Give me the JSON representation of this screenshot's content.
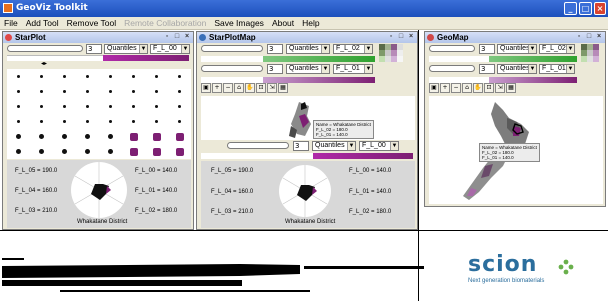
{
  "window": {
    "title": "GeoViz Toolkit",
    "controls": [
      "_",
      "□",
      "×"
    ]
  },
  "menu": {
    "items": [
      {
        "label": "File",
        "enabled": true
      },
      {
        "label": "Add Tool",
        "enabled": true
      },
      {
        "label": "Remove Tool",
        "enabled": true
      },
      {
        "label": "Remote Collaboration",
        "enabled": false
      },
      {
        "label": "Save Images",
        "enabled": true
      },
      {
        "label": "About",
        "enabled": true
      },
      {
        "label": "Help",
        "enabled": true
      }
    ]
  },
  "starplot": {
    "title": "StarPlot",
    "number": "3",
    "classification": "Quantiles",
    "variable": "F_L_00",
    "radar": {
      "labels": {
        "top_left": "F_L_05 = 190.0",
        "top_right": "F_L_00 = 140.0",
        "mid_left": "F_L_04 = 160.0",
        "mid_right": "F_L_01 = 140.0",
        "bot_left": "F_L_03 = 210.0",
        "bot_right": "F_L_02 = 180.0"
      },
      "caption": "Whakatane District"
    }
  },
  "starplotmap": {
    "title": "StarPlotMap",
    "number1": "3",
    "class1": "Quantiles",
    "var1": "F_L_02",
    "number2": "3",
    "class2": "Quantiles",
    "var2": "F_L_01",
    "tooltip": [
      "Name = Whakatane District",
      "F_L_02 = 180.0",
      "F_L_01 = 140.0"
    ],
    "number3": "3",
    "class3": "Quantiles",
    "var3": "F_L_00",
    "radar": {
      "labels": {
        "top_left": "F_L_05 = 190.0",
        "top_right": "F_L_00 = 140.0",
        "mid_left": "F_L_04 = 160.0",
        "mid_right": "F_L_01 = 140.0",
        "bot_left": "F_L_03 = 210.0",
        "bot_right": "F_L_02 = 180.0"
      },
      "caption": "Whakatane District"
    }
  },
  "geomap": {
    "title": "GeoMap",
    "number1": "3",
    "class1": "Quantiles",
    "var1": "F_L_02",
    "number2": "3",
    "class2": "Quantiles",
    "var2": "F_L_01",
    "tooltip": [
      "Name = Whakatane District",
      "F_L_02 = 180.0",
      "F_L_01 = 140.0"
    ]
  },
  "logo": {
    "name": "scion",
    "tagline": "Next generation biomaterials"
  },
  "colors": {
    "purple": "#7d1f73",
    "magenta": "#b02aa8",
    "green": "#2ea12e",
    "title_blue": "#1c4fbc"
  }
}
